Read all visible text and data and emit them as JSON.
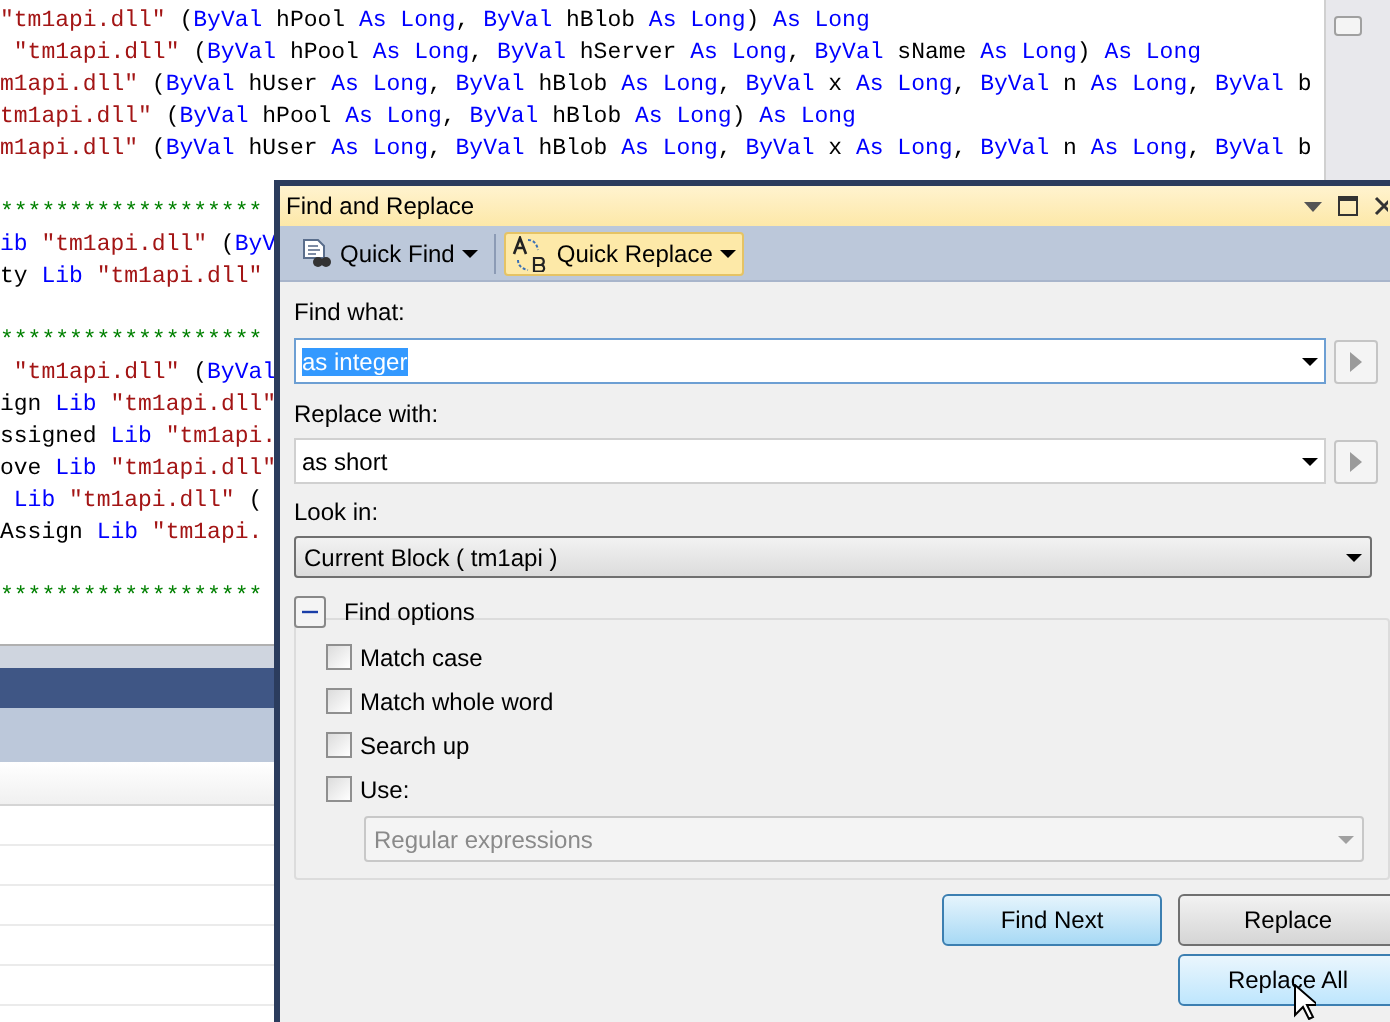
{
  "editor": {
    "lines": [
      {
        "kind": "code",
        "segments": [
          {
            "text": "\"tm1api.dll\"",
            "kind": "string"
          },
          {
            "text": " (",
            "kind": "plain"
          },
          {
            "text": "ByVal",
            "kind": "keyword"
          },
          {
            "text": " hPool ",
            "kind": "plain"
          },
          {
            "text": "As Long",
            "kind": "keyword"
          },
          {
            "text": ", ",
            "kind": "plain"
          },
          {
            "text": "ByVal",
            "kind": "keyword"
          },
          {
            "text": " hBlob ",
            "kind": "plain"
          },
          {
            "text": "As Long",
            "kind": "keyword"
          },
          {
            "text": ") ",
            "kind": "plain"
          },
          {
            "text": "As Long",
            "kind": "keyword"
          }
        ]
      },
      {
        "kind": "code",
        "segments": [
          {
            "text": " \"tm1api.dll\"",
            "kind": "string"
          },
          {
            "text": " (",
            "kind": "plain"
          },
          {
            "text": "ByVal",
            "kind": "keyword"
          },
          {
            "text": " hPool ",
            "kind": "plain"
          },
          {
            "text": "As Long",
            "kind": "keyword"
          },
          {
            "text": ", ",
            "kind": "plain"
          },
          {
            "text": "ByVal",
            "kind": "keyword"
          },
          {
            "text": " hServer ",
            "kind": "plain"
          },
          {
            "text": "As Long",
            "kind": "keyword"
          },
          {
            "text": ", ",
            "kind": "plain"
          },
          {
            "text": "ByVal",
            "kind": "keyword"
          },
          {
            "text": " sName ",
            "kind": "plain"
          },
          {
            "text": "As Long",
            "kind": "keyword"
          },
          {
            "text": ") ",
            "kind": "plain"
          },
          {
            "text": "As Long",
            "kind": "keyword"
          }
        ]
      },
      {
        "kind": "code",
        "segments": [
          {
            "text": "m1api.dll\"",
            "kind": "string"
          },
          {
            "text": " (",
            "kind": "plain"
          },
          {
            "text": "ByVal",
            "kind": "keyword"
          },
          {
            "text": " hUser ",
            "kind": "plain"
          },
          {
            "text": "As Long",
            "kind": "keyword"
          },
          {
            "text": ", ",
            "kind": "plain"
          },
          {
            "text": "ByVal",
            "kind": "keyword"
          },
          {
            "text": " hBlob ",
            "kind": "plain"
          },
          {
            "text": "As Long",
            "kind": "keyword"
          },
          {
            "text": ", ",
            "kind": "plain"
          },
          {
            "text": "ByVal",
            "kind": "keyword"
          },
          {
            "text": " x ",
            "kind": "plain"
          },
          {
            "text": "As Long",
            "kind": "keyword"
          },
          {
            "text": ", ",
            "kind": "plain"
          },
          {
            "text": "ByVal",
            "kind": "keyword"
          },
          {
            "text": " n ",
            "kind": "plain"
          },
          {
            "text": "As Long",
            "kind": "keyword"
          },
          {
            "text": ", ",
            "kind": "plain"
          },
          {
            "text": "ByVal",
            "kind": "keyword"
          },
          {
            "text": " b",
            "kind": "plain"
          }
        ]
      },
      {
        "kind": "code",
        "segments": [
          {
            "text": "tm1api.dll\"",
            "kind": "string"
          },
          {
            "text": " (",
            "kind": "plain"
          },
          {
            "text": "ByVal",
            "kind": "keyword"
          },
          {
            "text": " hPool ",
            "kind": "plain"
          },
          {
            "text": "As Long",
            "kind": "keyword"
          },
          {
            "text": ", ",
            "kind": "plain"
          },
          {
            "text": "ByVal",
            "kind": "keyword"
          },
          {
            "text": " hBlob ",
            "kind": "plain"
          },
          {
            "text": "As Long",
            "kind": "keyword"
          },
          {
            "text": ") ",
            "kind": "plain"
          },
          {
            "text": "As Long",
            "kind": "keyword"
          }
        ]
      },
      {
        "kind": "code",
        "segments": [
          {
            "text": "m1api.dll\"",
            "kind": "string"
          },
          {
            "text": " (",
            "kind": "plain"
          },
          {
            "text": "ByVal",
            "kind": "keyword"
          },
          {
            "text": " hUser ",
            "kind": "plain"
          },
          {
            "text": "As Long",
            "kind": "keyword"
          },
          {
            "text": ", ",
            "kind": "plain"
          },
          {
            "text": "ByVal",
            "kind": "keyword"
          },
          {
            "text": " hBlob ",
            "kind": "plain"
          },
          {
            "text": "As Long",
            "kind": "keyword"
          },
          {
            "text": ", ",
            "kind": "plain"
          },
          {
            "text": "ByVal",
            "kind": "keyword"
          },
          {
            "text": " x ",
            "kind": "plain"
          },
          {
            "text": "As Long",
            "kind": "keyword"
          },
          {
            "text": ", ",
            "kind": "plain"
          },
          {
            "text": "ByVal",
            "kind": "keyword"
          },
          {
            "text": " n ",
            "kind": "plain"
          },
          {
            "text": "As Long",
            "kind": "keyword"
          },
          {
            "text": ", ",
            "kind": "plain"
          },
          {
            "text": "ByVal",
            "kind": "keyword"
          },
          {
            "text": " b",
            "kind": "plain"
          }
        ]
      },
      {
        "kind": "blank"
      },
      {
        "kind": "code",
        "segments": [
          {
            "text": "*******************",
            "kind": "comment"
          }
        ]
      },
      {
        "kind": "code",
        "segments": [
          {
            "text": "ib",
            "kind": "keyword"
          },
          {
            "text": " \"tm1api.dll\"",
            "kind": "string"
          },
          {
            "text": " (",
            "kind": "plain"
          },
          {
            "text": "ByV",
            "kind": "keyword"
          }
        ]
      },
      {
        "kind": "code",
        "segments": [
          {
            "text": "ty ",
            "kind": "plain"
          },
          {
            "text": "Lib",
            "kind": "keyword"
          },
          {
            "text": " \"tm1api.dll\"",
            "kind": "string"
          }
        ]
      },
      {
        "kind": "blank"
      },
      {
        "kind": "code",
        "segments": [
          {
            "text": "*******************",
            "kind": "comment"
          }
        ]
      },
      {
        "kind": "code",
        "segments": [
          {
            "text": " \"tm1api.dll\"",
            "kind": "string"
          },
          {
            "text": " (",
            "kind": "plain"
          },
          {
            "text": "ByVal",
            "kind": "keyword"
          }
        ]
      },
      {
        "kind": "code",
        "segments": [
          {
            "text": "ign ",
            "kind": "plain"
          },
          {
            "text": "Lib",
            "kind": "keyword"
          },
          {
            "text": " \"tm1api.dll\"",
            "kind": "string"
          }
        ]
      },
      {
        "kind": "code",
        "segments": [
          {
            "text": "ssigned ",
            "kind": "plain"
          },
          {
            "text": "Lib",
            "kind": "keyword"
          },
          {
            "text": " \"tm1api.",
            "kind": "string"
          }
        ]
      },
      {
        "kind": "code",
        "segments": [
          {
            "text": "ove ",
            "kind": "plain"
          },
          {
            "text": "Lib",
            "kind": "keyword"
          },
          {
            "text": " \"tm1api.dll\"",
            "kind": "string"
          }
        ]
      },
      {
        "kind": "code",
        "segments": [
          {
            "text": " Lib",
            "kind": "keyword"
          },
          {
            "text": " \"tm1api.dll\"",
            "kind": "string"
          },
          {
            "text": " (",
            "kind": "plain"
          }
        ]
      },
      {
        "kind": "code",
        "segments": [
          {
            "text": "Assign ",
            "kind": "plain"
          },
          {
            "text": "Lib",
            "kind": "keyword"
          },
          {
            "text": " \"tm1api.",
            "kind": "string"
          }
        ]
      },
      {
        "kind": "blank"
      },
      {
        "kind": "code",
        "segments": [
          {
            "text": "*******************",
            "kind": "comment"
          }
        ]
      }
    ]
  },
  "dialog": {
    "title": "Find and Replace",
    "toolbar": [
      {
        "label": "Quick Find",
        "kind": "find",
        "selected": false
      },
      {
        "label": "Quick Replace",
        "kind": "replace",
        "selected": true
      }
    ],
    "find_what": {
      "label": "Find what:",
      "value": "as integer",
      "selected": true
    },
    "replace_with": {
      "label": "Replace with:",
      "value": "as short"
    },
    "look_in": {
      "label": "Look in:",
      "value": "Current Block ( tm1api )"
    },
    "find_options": {
      "label": "Find options",
      "expanded": true,
      "options": [
        {
          "label": "Match case",
          "checked": false
        },
        {
          "label": "Match whole word",
          "checked": false
        },
        {
          "label": "Search up",
          "checked": false
        },
        {
          "label": "Use:",
          "checked": false
        }
      ],
      "use_select": {
        "value": "Regular expressions",
        "disabled": true
      }
    },
    "buttons": [
      {
        "label": "Find Next",
        "kind": "default"
      },
      {
        "label": "Replace",
        "kind": "normal"
      },
      {
        "label": "Replace All",
        "kind": "hover"
      }
    ]
  }
}
